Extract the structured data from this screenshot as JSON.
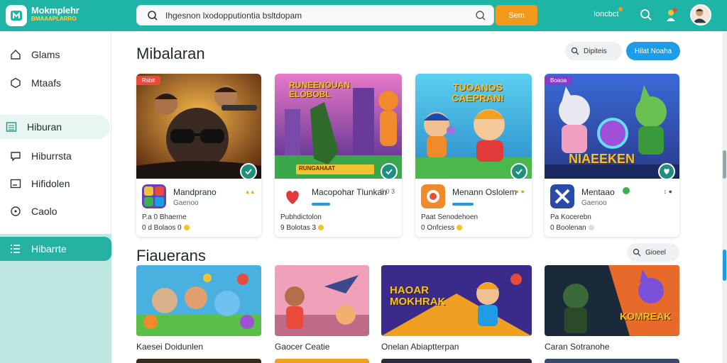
{
  "colors": {
    "topbar": "#1fb5a6",
    "accent": "#f29a1d",
    "primary": "#1e9ce6",
    "active": "#25b2a3"
  },
  "brand": {
    "name": "Mokmplehr",
    "subtitle": "BMAAAPLARRO"
  },
  "search": {
    "value": "Ihgesnon lxodopputiontia bsltdopam",
    "button": "Sem"
  },
  "header": {
    "link": "Ioncbct"
  },
  "sidebar": {
    "items": [
      {
        "label": "Glams",
        "icon": "home-icon"
      },
      {
        "label": "Mtaafs",
        "icon": "hexagon-icon"
      },
      {
        "label": "Hiburan",
        "icon": "list-icon"
      },
      {
        "label": "Hiburrsta",
        "icon": "chat-icon"
      },
      {
        "label": "Hifidolen",
        "icon": "window-icon"
      },
      {
        "label": "Caolo",
        "icon": "circle-dot-icon"
      },
      {
        "label": "Hibarrte",
        "icon": "menu-icon"
      }
    ]
  },
  "section1": {
    "title": "Mibalaran",
    "filter_label": "Dipiteis",
    "action_label": "Hilat Noaha",
    "cards": [
      {
        "tag": "Rsbit",
        "title": "Mandprano",
        "sub": "Gaenoo",
        "right": "▴ ▴",
        "meta1": "P.a 0 Bhaerne",
        "meta2": "0 d Bolaos 0"
      },
      {
        "tag": "",
        "art_title": "RUNEENOUAN ELOBOBL",
        "art_caption": "RUNGAHAAT",
        "title": "Macopohar Tlunkan",
        "sub": "",
        "right": "S 0 3",
        "meta1": "Pubhdictolon",
        "meta2": "9 Bolotas 3"
      },
      {
        "tag": "",
        "art_title": "TUOANOS CAEPRAN!",
        "title": "Menann Oslolem",
        "sub": "",
        "right": "● ●",
        "meta1": "Paat Senodehoen",
        "meta2": "0 Onfciess"
      },
      {
        "tag": "Boaoa",
        "art_title": "NIAEEKEN",
        "title": "Mentaao",
        "sub": "Gaenoo",
        "right": "↕ ●",
        "meta1": "Pa Kocerebn",
        "meta2": "0 Boolenan"
      }
    ]
  },
  "section2": {
    "title": "Fiauerans",
    "filter_label": "Gioeel",
    "cards": [
      {
        "label": "Kaesei Doidunlen"
      },
      {
        "label": "Gaocer Ceatie",
        "art_title": ""
      },
      {
        "label": "Onelan Abiaptterpan",
        "art_title": "HAOAR MOKHRAK"
      },
      {
        "label": "Caran Sotranohe",
        "art_title": "KOMREAK"
      }
    ]
  }
}
